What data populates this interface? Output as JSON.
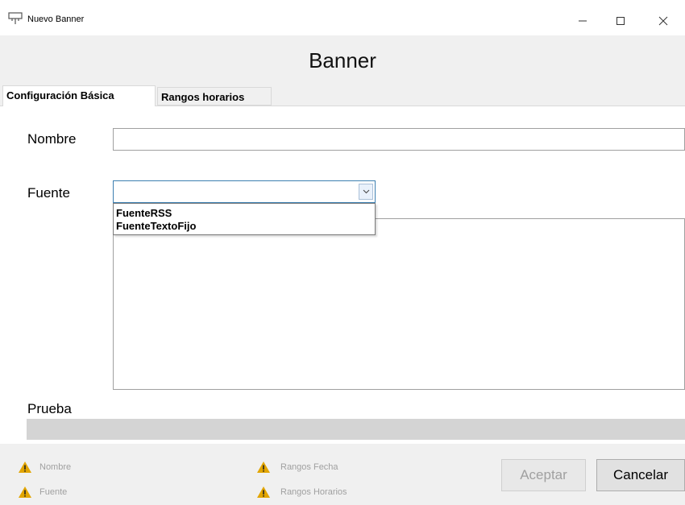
{
  "window": {
    "title": "Nuevo Banner"
  },
  "header": {
    "title": "Banner"
  },
  "tabs": [
    {
      "label": "Configuración Básica",
      "selected": true
    },
    {
      "label": "Rangos horarios",
      "selected": false
    }
  ],
  "form": {
    "nombre_label": "Nombre",
    "nombre_value": "",
    "fuente_label": "Fuente",
    "fuente_value": "",
    "fuente_options": [
      "FuenteRSS",
      "FuenteTextoFijo"
    ],
    "prueba_label": "Prueba"
  },
  "validation": [
    {
      "label": "Nombre",
      "icon": "warning-icon"
    },
    {
      "label": "Fuente",
      "icon": "warning-icon"
    },
    {
      "label": "Rangos Fecha",
      "icon": "warning-icon"
    },
    {
      "label": "Rangos Horarios",
      "icon": "warning-icon"
    }
  ],
  "buttons": {
    "aceptar": "Aceptar",
    "cancelar": "Cancelar"
  },
  "colors": {
    "warning": "#e2a500",
    "accent_border": "#3c7fb1",
    "disabled_text": "#a0a0a0"
  }
}
